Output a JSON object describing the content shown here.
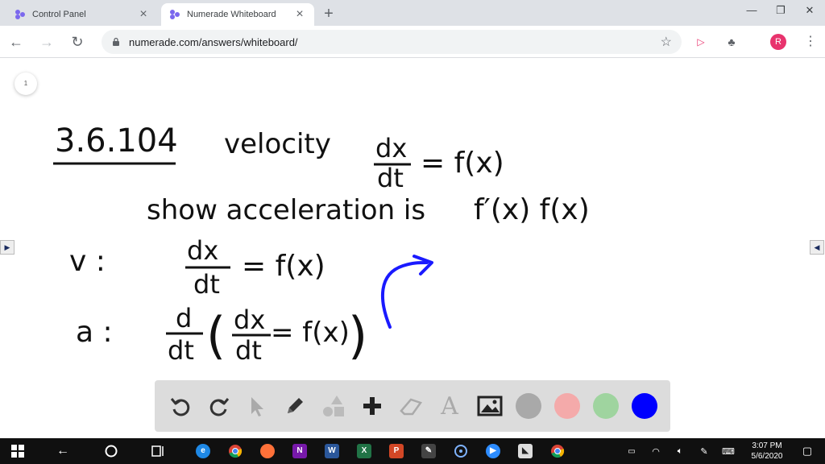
{
  "browser": {
    "tabs": [
      {
        "title": "Control Panel",
        "active": false
      },
      {
        "title": "Numerade Whiteboard",
        "active": true
      }
    ],
    "url": "numerade.com/answers/whiteboard/",
    "profile_initial": "R",
    "window_controls": [
      "minimize-icon",
      "restore-icon",
      "close-icon"
    ]
  },
  "whiteboard": {
    "page_number": "1",
    "handwriting": {
      "problem_number": "3.6.104",
      "velocity_label": "velocity",
      "velocity_eq_num": "dx",
      "velocity_eq_den": "dt",
      "velocity_eq_rhs": "= f(x)",
      "show_text": "show acceleration is",
      "show_result": "f′(x) f(x)",
      "v_label": "v :",
      "v_eq_num": "dx",
      "v_eq_den": "dt",
      "v_eq_rhs": "= f(x)",
      "a_label": "a :",
      "a_d_num": "d",
      "a_d_den": "dt",
      "a_inner_num": "dx",
      "a_inner_den": "dt",
      "a_inner_rhs": "= f(x)",
      "ink_color": "#111111",
      "arrow_color": "#1a1aff"
    },
    "tools": [
      "undo-icon",
      "redo-icon",
      "pointer-icon",
      "pen-icon",
      "shapes-icon",
      "add-icon",
      "eraser-icon",
      "text-icon",
      "image-icon"
    ],
    "colors": [
      "#a9a9a9",
      "#f4aaaa",
      "#9fd49f",
      "#0000ff"
    ]
  },
  "taskbar": {
    "time": "3:07 PM",
    "date": "5/6/2020"
  }
}
